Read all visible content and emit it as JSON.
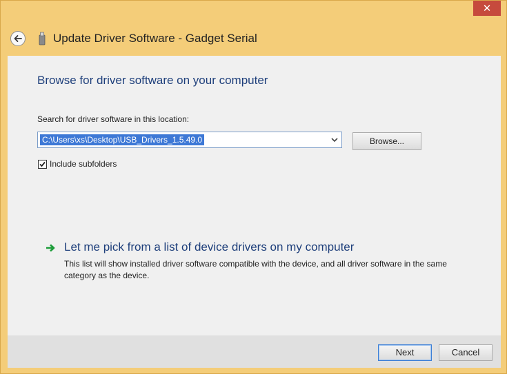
{
  "window": {
    "close_glyph": "✕",
    "title": "Update Driver Software - Gadget Serial"
  },
  "icons": {
    "close": "close-icon",
    "back": "back-arrow-icon",
    "device": "usb-device-icon",
    "dropdown": "chevron-down-icon",
    "checkmark": "checkmark-icon",
    "link_arrow": "green-arrow-icon"
  },
  "colors": {
    "frame": "#f4cd79",
    "close_button": "#c64a3d",
    "heading": "#1e3f7b",
    "selection": "#3d78d6",
    "link_arrow": "#1d9d3a"
  },
  "main": {
    "heading": "Browse for driver software on your computer",
    "search_label": "Search for driver software in this location:",
    "path_value": "C:\\Users\\xs\\Desktop\\USB_Drivers_1.5.49.0",
    "browse_label": "Browse...",
    "include_subfolders_label": "Include subfolders",
    "include_subfolders_checked": true,
    "pick_link": "Let me pick from a list of device drivers on my computer",
    "pick_description": "This list will show installed driver software compatible with the device, and all driver software in the same category as the device."
  },
  "footer": {
    "next_label": "Next",
    "cancel_label": "Cancel"
  }
}
